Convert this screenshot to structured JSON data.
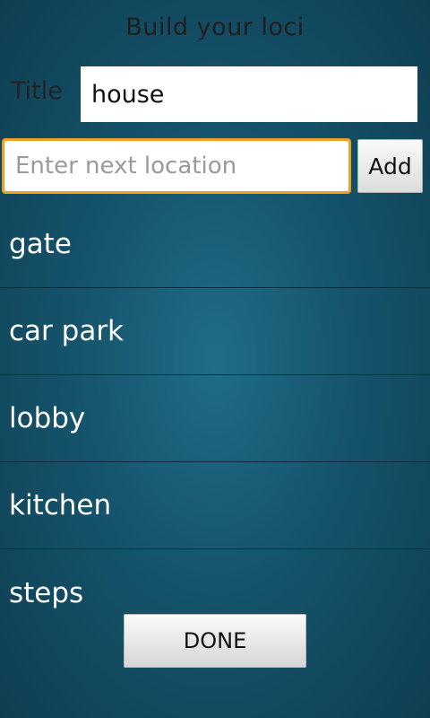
{
  "header": {
    "title": "Build your loci"
  },
  "form": {
    "title_label": "Title",
    "title_value": "house",
    "location_placeholder": "Enter next location",
    "location_value": "",
    "add_label": "Add"
  },
  "locations": [
    {
      "label": "gate"
    },
    {
      "label": "car park"
    },
    {
      "label": "lobby"
    },
    {
      "label": "kitchen"
    },
    {
      "label": "steps"
    }
  ],
  "footer": {
    "done_label": "DONE"
  },
  "colors": {
    "accent_focus": "#f0a020",
    "background": "#15546c"
  }
}
